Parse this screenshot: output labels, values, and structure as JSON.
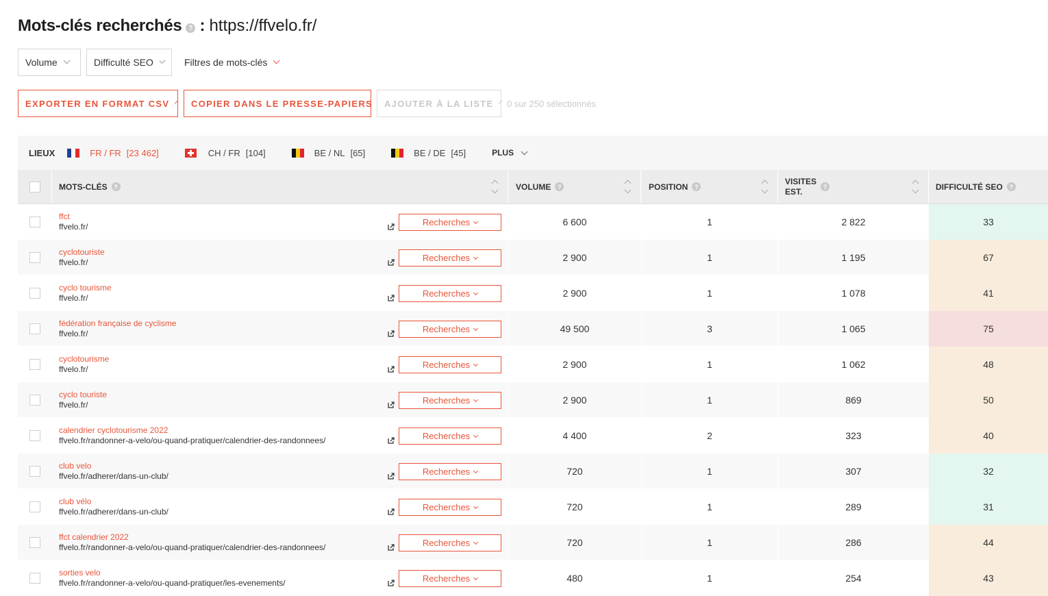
{
  "header": {
    "title": "Mots-clés recherchés",
    "help": "?",
    "separator": ":",
    "url": "https://ffvelo.fr/"
  },
  "filters": {
    "volume": "Volume",
    "difficulty": "Difficulté SEO",
    "keyword_filters": "Filtres de mots-clés"
  },
  "actions": {
    "export_csv": "EXPORTER EN FORMAT CSV",
    "copy_clipboard": "COPIER DANS LE PRESSE-PAPIERS",
    "add_to_list": "AJOUTER À LA LISTE",
    "selected_count": "0 sur 250 sélectionnés"
  },
  "locations": {
    "label": "LIEUX",
    "items": [
      {
        "label": "FR / FR",
        "count": "[23 462]",
        "flag": "france-flag",
        "active": true
      },
      {
        "label": "CH / FR",
        "count": "[104]",
        "flag": "switzerland-flag",
        "active": false
      },
      {
        "label": "BE / NL",
        "count": "[65]",
        "flag": "belgium-flag",
        "active": false
      },
      {
        "label": "BE / DE",
        "count": "[45]",
        "flag": "belgium-flag",
        "active": false
      }
    ],
    "more": "PLUS"
  },
  "table": {
    "headers": {
      "keywords": "MOTS-CLÉS",
      "volume": "VOLUME",
      "position": "POSITION",
      "visits_line1": "VISITES",
      "visits_line2": "EST.",
      "difficulty": "DIFFICULTÉ SEO"
    },
    "research_label": "Recherches",
    "rows": [
      {
        "keyword": "ffct",
        "url": "ffvelo.fr/",
        "volume": "6 600",
        "position": "1",
        "visits": "2 822",
        "difficulty": "33",
        "diff_color": "#e3f6ef"
      },
      {
        "keyword": "cyclotouriste",
        "url": "ffvelo.fr/",
        "volume": "2 900",
        "position": "1",
        "visits": "1 195",
        "difficulty": "67",
        "diff_color": "#f9ecdc"
      },
      {
        "keyword": "cyclo tourisme",
        "url": "ffvelo.fr/",
        "volume": "2 900",
        "position": "1",
        "visits": "1 078",
        "difficulty": "41",
        "diff_color": "#f9ecdc"
      },
      {
        "keyword": "fédération française de cyclisme",
        "url": "ffvelo.fr/",
        "volume": "49 500",
        "position": "3",
        "visits": "1 065",
        "difficulty": "75",
        "diff_color": "#f7dede"
      },
      {
        "keyword": "cyclotourisme",
        "url": "ffvelo.fr/",
        "volume": "2 900",
        "position": "1",
        "visits": "1 062",
        "difficulty": "48",
        "diff_color": "#f9ecdc"
      },
      {
        "keyword": "cyclo touriste",
        "url": "ffvelo.fr/",
        "volume": "2 900",
        "position": "1",
        "visits": "869",
        "difficulty": "50",
        "diff_color": "#f9ecdc"
      },
      {
        "keyword": "calendrier cyclotourisme 2022",
        "url": "ffvelo.fr/randonner-a-velo/ou-quand-pratiquer/calendrier-des-randonnees/",
        "volume": "4 400",
        "position": "2",
        "visits": "323",
        "difficulty": "40",
        "diff_color": "#f9ecdc"
      },
      {
        "keyword": "club velo",
        "url": "ffvelo.fr/adherer/dans-un-club/",
        "volume": "720",
        "position": "1",
        "visits": "307",
        "difficulty": "32",
        "diff_color": "#e3f6ef"
      },
      {
        "keyword": "club vélo",
        "url": "ffvelo.fr/adherer/dans-un-club/",
        "volume": "720",
        "position": "1",
        "visits": "289",
        "difficulty": "31",
        "diff_color": "#e3f6ef"
      },
      {
        "keyword": "ffct calendrier 2022",
        "url": "ffvelo.fr/randonner-a-velo/ou-quand-pratiquer/calendrier-des-randonnees/",
        "volume": "720",
        "position": "1",
        "visits": "286",
        "difficulty": "44",
        "diff_color": "#f9ecdc"
      },
      {
        "keyword": "sorties velo",
        "url": "ffvelo.fr/randonner-a-velo/ou-quand-pratiquer/les-evenements/",
        "volume": "480",
        "position": "1",
        "visits": "254",
        "difficulty": "43",
        "diff_color": "#f9ecdc"
      }
    ]
  },
  "colors": {
    "accent": "#e8553a",
    "header_bg": "#ececec",
    "locations_bg": "#f6f6f6"
  }
}
